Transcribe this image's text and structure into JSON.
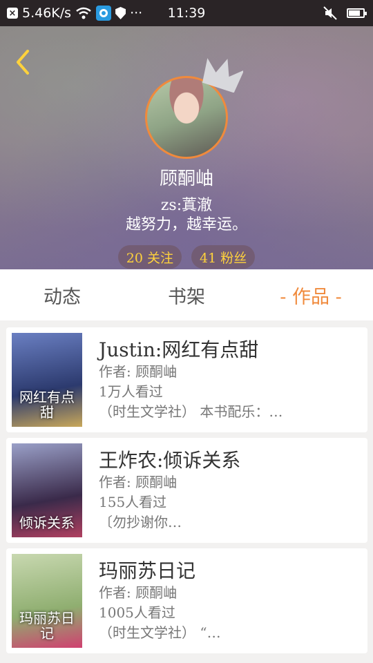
{
  "status_bar": {
    "speed": "5.46K/s",
    "time": "11:39",
    "icons": [
      "close-box-icon",
      "wifi-icon",
      "app-icon",
      "shield-icon",
      "more-dots-icon",
      "mute-icon",
      "battery-icon"
    ]
  },
  "profile": {
    "name": "顾酮岫",
    "bio_line1": "zs:蒖澈",
    "bio_line2": "越努力，越幸运。",
    "following": "20 关注",
    "followers": "41 粉丝"
  },
  "tabs": [
    {
      "label": "动态"
    },
    {
      "label": "书架"
    },
    {
      "label": "- 作品 -",
      "active": true
    }
  ],
  "works": [
    {
      "title": "Justin:网红有点甜",
      "author": "作者: 顾酮岫",
      "views": "1万人看过",
      "desc": "（时生文学社） 本书配乐：…",
      "cover_text": "网红有点甜",
      "cover_colors": [
        "#6a7fc2",
        "#2c3a6e",
        "#c9a85a"
      ]
    },
    {
      "title": "王炸农:倾诉关系",
      "author": "作者: 顾酮岫",
      "views": "155人看过",
      "desc": "〔勿抄谢你…",
      "cover_text": "倾诉关系",
      "cover_colors": [
        "#9aa0c8",
        "#3a2a4a",
        "#b04060"
      ]
    },
    {
      "title": "玛丽苏日记",
      "author": "作者: 顾酮岫",
      "views": "1005人看过",
      "desc": "（时生文学社） “…",
      "cover_text": "玛丽苏日记",
      "cover_colors": [
        "#c8d8b0",
        "#8fae70",
        "#d04070"
      ]
    }
  ],
  "colors": {
    "accent": "#f08a3c",
    "stat_text": "#ffd23c"
  }
}
